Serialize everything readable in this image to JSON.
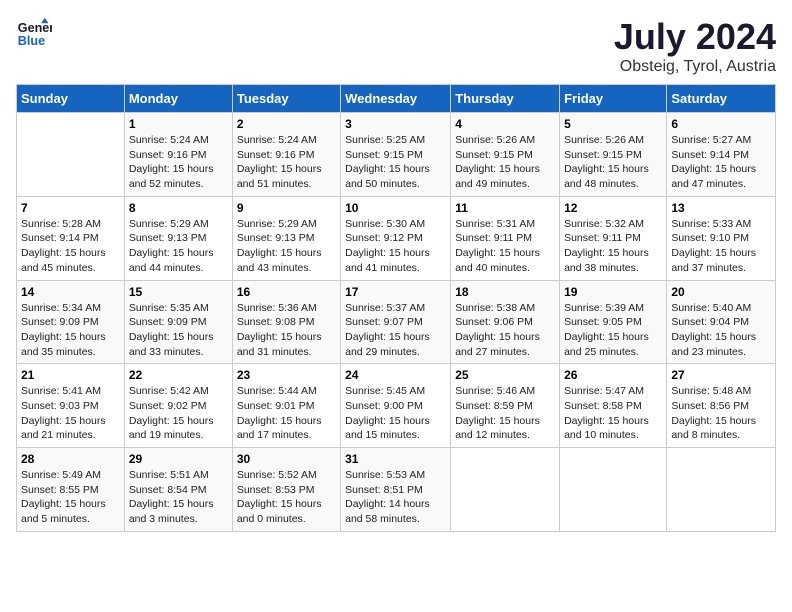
{
  "logo": {
    "line1": "General",
    "line2": "Blue"
  },
  "title": "July 2024",
  "subtitle": "Obsteig, Tyrol, Austria",
  "days_of_week": [
    "Sunday",
    "Monday",
    "Tuesday",
    "Wednesday",
    "Thursday",
    "Friday",
    "Saturday"
  ],
  "weeks": [
    [
      {
        "day": "",
        "info": ""
      },
      {
        "day": "1",
        "info": "Sunrise: 5:24 AM\nSunset: 9:16 PM\nDaylight: 15 hours\nand 52 minutes."
      },
      {
        "day": "2",
        "info": "Sunrise: 5:24 AM\nSunset: 9:16 PM\nDaylight: 15 hours\nand 51 minutes."
      },
      {
        "day": "3",
        "info": "Sunrise: 5:25 AM\nSunset: 9:15 PM\nDaylight: 15 hours\nand 50 minutes."
      },
      {
        "day": "4",
        "info": "Sunrise: 5:26 AM\nSunset: 9:15 PM\nDaylight: 15 hours\nand 49 minutes."
      },
      {
        "day": "5",
        "info": "Sunrise: 5:26 AM\nSunset: 9:15 PM\nDaylight: 15 hours\nand 48 minutes."
      },
      {
        "day": "6",
        "info": "Sunrise: 5:27 AM\nSunset: 9:14 PM\nDaylight: 15 hours\nand 47 minutes."
      }
    ],
    [
      {
        "day": "7",
        "info": "Sunrise: 5:28 AM\nSunset: 9:14 PM\nDaylight: 15 hours\nand 45 minutes."
      },
      {
        "day": "8",
        "info": "Sunrise: 5:29 AM\nSunset: 9:13 PM\nDaylight: 15 hours\nand 44 minutes."
      },
      {
        "day": "9",
        "info": "Sunrise: 5:29 AM\nSunset: 9:13 PM\nDaylight: 15 hours\nand 43 minutes."
      },
      {
        "day": "10",
        "info": "Sunrise: 5:30 AM\nSunset: 9:12 PM\nDaylight: 15 hours\nand 41 minutes."
      },
      {
        "day": "11",
        "info": "Sunrise: 5:31 AM\nSunset: 9:11 PM\nDaylight: 15 hours\nand 40 minutes."
      },
      {
        "day": "12",
        "info": "Sunrise: 5:32 AM\nSunset: 9:11 PM\nDaylight: 15 hours\nand 38 minutes."
      },
      {
        "day": "13",
        "info": "Sunrise: 5:33 AM\nSunset: 9:10 PM\nDaylight: 15 hours\nand 37 minutes."
      }
    ],
    [
      {
        "day": "14",
        "info": "Sunrise: 5:34 AM\nSunset: 9:09 PM\nDaylight: 15 hours\nand 35 minutes."
      },
      {
        "day": "15",
        "info": "Sunrise: 5:35 AM\nSunset: 9:09 PM\nDaylight: 15 hours\nand 33 minutes."
      },
      {
        "day": "16",
        "info": "Sunrise: 5:36 AM\nSunset: 9:08 PM\nDaylight: 15 hours\nand 31 minutes."
      },
      {
        "day": "17",
        "info": "Sunrise: 5:37 AM\nSunset: 9:07 PM\nDaylight: 15 hours\nand 29 minutes."
      },
      {
        "day": "18",
        "info": "Sunrise: 5:38 AM\nSunset: 9:06 PM\nDaylight: 15 hours\nand 27 minutes."
      },
      {
        "day": "19",
        "info": "Sunrise: 5:39 AM\nSunset: 9:05 PM\nDaylight: 15 hours\nand 25 minutes."
      },
      {
        "day": "20",
        "info": "Sunrise: 5:40 AM\nSunset: 9:04 PM\nDaylight: 15 hours\nand 23 minutes."
      }
    ],
    [
      {
        "day": "21",
        "info": "Sunrise: 5:41 AM\nSunset: 9:03 PM\nDaylight: 15 hours\nand 21 minutes."
      },
      {
        "day": "22",
        "info": "Sunrise: 5:42 AM\nSunset: 9:02 PM\nDaylight: 15 hours\nand 19 minutes."
      },
      {
        "day": "23",
        "info": "Sunrise: 5:44 AM\nSunset: 9:01 PM\nDaylight: 15 hours\nand 17 minutes."
      },
      {
        "day": "24",
        "info": "Sunrise: 5:45 AM\nSunset: 9:00 PM\nDaylight: 15 hours\nand 15 minutes."
      },
      {
        "day": "25",
        "info": "Sunrise: 5:46 AM\nSunset: 8:59 PM\nDaylight: 15 hours\nand 12 minutes."
      },
      {
        "day": "26",
        "info": "Sunrise: 5:47 AM\nSunset: 8:58 PM\nDaylight: 15 hours\nand 10 minutes."
      },
      {
        "day": "27",
        "info": "Sunrise: 5:48 AM\nSunset: 8:56 PM\nDaylight: 15 hours\nand 8 minutes."
      }
    ],
    [
      {
        "day": "28",
        "info": "Sunrise: 5:49 AM\nSunset: 8:55 PM\nDaylight: 15 hours\nand 5 minutes."
      },
      {
        "day": "29",
        "info": "Sunrise: 5:51 AM\nSunset: 8:54 PM\nDaylight: 15 hours\nand 3 minutes."
      },
      {
        "day": "30",
        "info": "Sunrise: 5:52 AM\nSunset: 8:53 PM\nDaylight: 15 hours\nand 0 minutes."
      },
      {
        "day": "31",
        "info": "Sunrise: 5:53 AM\nSunset: 8:51 PM\nDaylight: 14 hours\nand 58 minutes."
      },
      {
        "day": "",
        "info": ""
      },
      {
        "day": "",
        "info": ""
      },
      {
        "day": "",
        "info": ""
      }
    ]
  ]
}
